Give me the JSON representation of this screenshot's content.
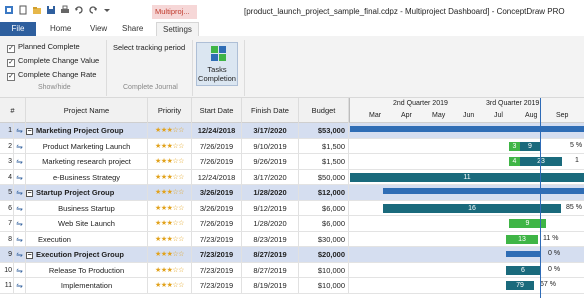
{
  "window": {
    "title": "[product_launch_project_sample_final.cdpz - Multiproject Dashboard] - ConceptDraw PRO",
    "context_tab_group": "Multiproj..."
  },
  "tabs": [
    "File",
    "Home",
    "View",
    "Share",
    "Settings"
  ],
  "ribbon": {
    "show_hide": {
      "items": [
        "Planned Complete",
        "Complete Change Value",
        "Complete Change Rate"
      ],
      "label": "Show/hide"
    },
    "complete_journal": {
      "select_period": "Select tracking period",
      "label": "Complete Journal"
    },
    "tasks_completion": {
      "line1": "Tasks",
      "line2": "Completion"
    }
  },
  "table": {
    "headers": {
      "num": "#",
      "name": "Project Name",
      "priority": "Priority",
      "start": "Start Date",
      "finish": "Finish Date",
      "budget": "Budget"
    },
    "rows": [
      {
        "num": "1",
        "name": "Marketing Project Group",
        "priority": "★★★☆☆",
        "start": "12/24/2018",
        "finish": "3/17/2020",
        "budget": "$53,000"
      },
      {
        "num": "2",
        "name": "Product Marketing Launch",
        "priority": "★★★☆☆",
        "start": "7/26/2019",
        "finish": "9/10/2019",
        "budget": "$1,500"
      },
      {
        "num": "3",
        "name": "Marketing research project",
        "priority": "★★★☆☆",
        "start": "7/26/2019",
        "finish": "9/26/2019",
        "budget": "$1,500"
      },
      {
        "num": "4",
        "name": "e-Business Strategy",
        "priority": "★★★☆☆",
        "start": "12/24/2018",
        "finish": "3/17/2020",
        "budget": "$50,000"
      },
      {
        "num": "5",
        "name": "Startup Project Group",
        "priority": "★★★☆☆",
        "start": "3/26/2019",
        "finish": "1/28/2020",
        "budget": "$12,000"
      },
      {
        "num": "6",
        "name": "Business Startup",
        "priority": "★★★☆☆",
        "start": "3/26/2019",
        "finish": "9/12/2019",
        "budget": "$6,000"
      },
      {
        "num": "7",
        "name": "Web Site Launch",
        "priority": "★★★☆☆",
        "start": "7/26/2019",
        "finish": "1/28/2020",
        "budget": "$6,000"
      },
      {
        "num": "8",
        "name": "Execution",
        "priority": "★★★☆☆",
        "start": "7/23/2019",
        "finish": "8/23/2019",
        "budget": "$30,000"
      },
      {
        "num": "9",
        "name": "Execution Project Group",
        "priority": "★★★☆☆",
        "start": "7/23/2019",
        "finish": "8/27/2019",
        "budget": "$20,000"
      },
      {
        "num": "10",
        "name": "Release To Production",
        "priority": "★★★☆☆",
        "start": "7/23/2019",
        "finish": "8/27/2019",
        "budget": "$10,000"
      },
      {
        "num": "11",
        "name": "Implementation",
        "priority": "★★★☆☆",
        "start": "7/23/2019",
        "finish": "8/19/2019",
        "budget": "$10,000"
      }
    ]
  },
  "timeline": {
    "quarters": [
      "2nd Quarter 2019",
      "3rd Quarter 2019"
    ],
    "months": [
      "Mar",
      "Apr",
      "May",
      "Jun",
      "Jul",
      "Aug",
      "Sep"
    ],
    "bar_labels": {
      "r2": "3",
      "r2b": "9",
      "r2pct": "5 %",
      "r3": "4",
      "r3b": "23",
      "r3pct": "1",
      "r4": "11",
      "r6": "16",
      "r6pct": "85 %",
      "r7": "9",
      "r8": "13",
      "r8pct": "11 %",
      "r9pct": "0 %",
      "r10": "6",
      "r10pct": "0 %",
      "r11": "79",
      "r11pct": "67 %"
    }
  },
  "colors": {
    "accent": "#2e5f9e",
    "summary_row": "#d5def0",
    "bar_dark": "#1a6a7c",
    "bar_green": "#3fb546",
    "bar_blue": "#2f6db5"
  }
}
